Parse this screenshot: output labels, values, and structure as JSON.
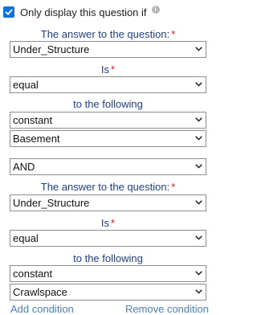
{
  "header": {
    "checked": true,
    "label": "Only display this question if",
    "info_glyph": "i"
  },
  "conditions": [
    {
      "question_label": "The answer to the question:",
      "question_value": "Under_Structure",
      "is_label": "Is",
      "is_value": "equal",
      "following_label": "to the following",
      "type_value": "constant",
      "constant_value": "Basement"
    },
    {
      "question_label": "The answer to the question:",
      "question_value": "Under_Structure",
      "is_label": "Is",
      "is_value": "equal",
      "following_label": "to the following",
      "type_value": "constant",
      "constant_value": "Crawlspace"
    }
  ],
  "connector": {
    "value": "AND"
  },
  "required_marker": "*",
  "footer": {
    "add": "Add condition",
    "remove": "Remove condition"
  },
  "colors": {
    "accent": "#0b73d9",
    "label": "#1f3f8a",
    "required": "#d01c1c",
    "link": "#4a7fbf"
  }
}
